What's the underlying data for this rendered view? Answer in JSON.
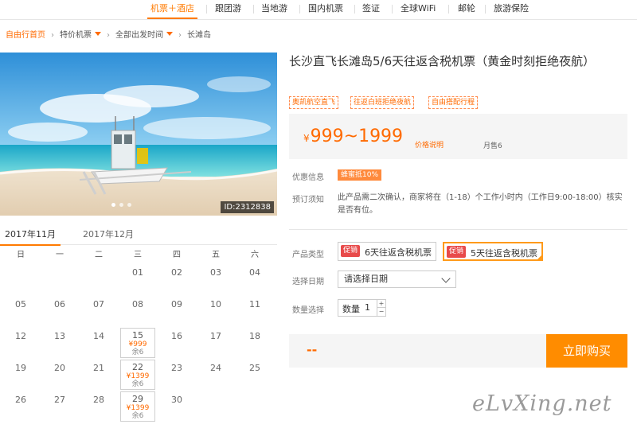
{
  "nav": {
    "items": [
      {
        "label": "机票＋酒店",
        "active": true
      },
      {
        "label": "跟团游"
      },
      {
        "label": "当地游"
      },
      {
        "label": "国内机票"
      },
      {
        "label": "签证"
      },
      {
        "label": "全球WiFi"
      },
      {
        "label": "邮轮"
      },
      {
        "label": "旅游保险"
      }
    ]
  },
  "breadcrumb": {
    "home": "自由行首页",
    "level2": "特价机票",
    "level3": "全部出发时间",
    "current": "长滩岛"
  },
  "hero": {
    "id_badge": "ID:2312838"
  },
  "calendar": {
    "tabs": [
      "2017年11月",
      "2017年12月"
    ],
    "active_tab": 0,
    "weekdays": [
      "日",
      "一",
      "二",
      "三",
      "四",
      "五",
      "六"
    ],
    "weeks": [
      [
        null,
        null,
        null,
        {
          "d": "01"
        },
        {
          "d": "02"
        },
        {
          "d": "03"
        },
        {
          "d": "04"
        }
      ],
      [
        {
          "d": "05"
        },
        {
          "d": "06"
        },
        {
          "d": "07"
        },
        {
          "d": "08"
        },
        {
          "d": "09"
        },
        {
          "d": "10"
        },
        {
          "d": "11"
        }
      ],
      [
        {
          "d": "12"
        },
        {
          "d": "13"
        },
        {
          "d": "14"
        },
        {
          "d": "15",
          "price": "¥999",
          "remain": "余6"
        },
        {
          "d": "16"
        },
        {
          "d": "17"
        },
        {
          "d": "18"
        }
      ],
      [
        {
          "d": "19"
        },
        {
          "d": "20"
        },
        {
          "d": "21"
        },
        {
          "d": "22",
          "price": "¥1399",
          "remain": "余6"
        },
        {
          "d": "23"
        },
        {
          "d": "24"
        },
        {
          "d": "25"
        }
      ],
      [
        {
          "d": "26"
        },
        {
          "d": "27"
        },
        {
          "d": "28"
        },
        {
          "d": "29",
          "price": "¥1399",
          "remain": "余6"
        },
        {
          "d": "30"
        },
        null,
        null
      ]
    ]
  },
  "product": {
    "title": "长沙直飞长滩岛5/6天往返含税机票（黄金时刻拒绝夜航）",
    "tags": [
      "奥凯航空直飞",
      "往返白班拒绝夜航",
      "自由搭配行程"
    ],
    "price_currency": "¥",
    "price_range": "999~1999",
    "price_note": "价格说明",
    "sold": "月售6",
    "coupon_label": "优惠信息",
    "coupon": "蜂蜜抵10%",
    "notice_label": "预订须知",
    "notice": "此产品需二次确认，商家将在（1-18）个工作小时内（工作日9:00-18:00）核实是否有位。",
    "type_label": "产品类型",
    "options": [
      {
        "promo": "促销",
        "text": "6天往返含税机票",
        "selected": false
      },
      {
        "promo": "促销",
        "text": "5天往返含税机票",
        "selected": true
      }
    ],
    "date_label": "选择日期",
    "date_placeholder": "请选择日期",
    "qty_label": "数量选择",
    "qty_text": "数量",
    "qty_value": "1",
    "qty_plus": "+",
    "qty_minus": "−",
    "total": "--",
    "buy": "立即购买"
  },
  "watermark": "eLvXing.net",
  "colors": {
    "accent": "#ff7a00",
    "buy": "#ff8c00",
    "promo": "#e84a4a"
  }
}
